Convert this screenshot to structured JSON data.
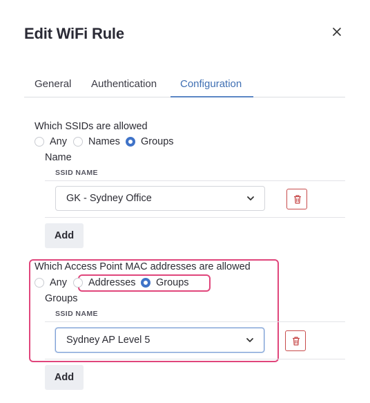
{
  "dialog": {
    "title": "Edit WiFi Rule",
    "close_icon": "close-icon"
  },
  "tabs": [
    {
      "label": "General",
      "active": false
    },
    {
      "label": "Authentication",
      "active": false
    },
    {
      "label": "Configuration",
      "active": true
    }
  ],
  "ssids": {
    "question": "Which SSIDs are allowed",
    "options": [
      {
        "label": "Any",
        "checked": false
      },
      {
        "label": "Names",
        "checked": false
      },
      {
        "label": "Groups",
        "checked": true
      }
    ],
    "sub_label": "Name",
    "column_header": "SSID NAME",
    "rows": [
      {
        "value": "GK - Sydney Office"
      }
    ],
    "add_label": "Add"
  },
  "ap_mac": {
    "question": "Which Access Point MAC addresses are allowed",
    "options": [
      {
        "label": "Any",
        "checked": false
      },
      {
        "label": "Addresses",
        "checked": false
      },
      {
        "label": "Groups",
        "checked": true
      }
    ],
    "sub_label": "Groups",
    "column_header": "SSID NAME",
    "rows": [
      {
        "value": "Sydney AP Level 5"
      }
    ],
    "add_label": "Add"
  },
  "colors": {
    "accent": "#3f73c8",
    "highlight": "#e0457b",
    "danger": "#c74a4a"
  }
}
